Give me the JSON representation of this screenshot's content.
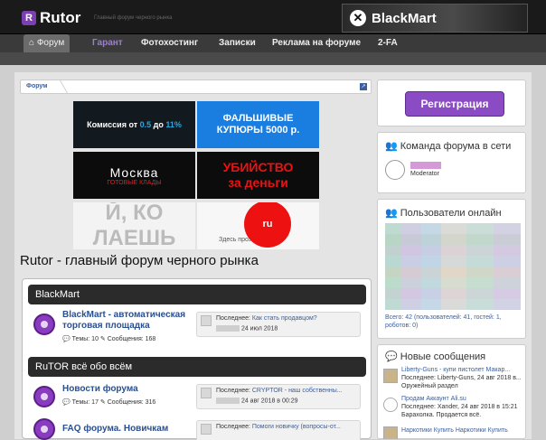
{
  "header": {
    "logo_text": "Rutor",
    "tagline": "Главный форум черного рынка",
    "banner_text": "BlackMart"
  },
  "nav": {
    "items": [
      {
        "label": "Форум",
        "icon": "home-icon",
        "active": true
      },
      {
        "label": "Гарант"
      },
      {
        "label": "Фотохостинг"
      },
      {
        "label": "Записки"
      },
      {
        "label": "Реклама на форуме"
      },
      {
        "label": "2-FA"
      }
    ]
  },
  "breadcrumb": {
    "label": "Форум"
  },
  "ads": {
    "ad1": {
      "prefix": "Комиссия от ",
      "a": "0.5",
      "mid": " до ",
      "b": "11%"
    },
    "ad2": {
      "line1": "ФАЛЬШИВЫЕ",
      "line2": "КУПЮРЫ 5000 р."
    },
    "ad3": {
      "line1": "Москва",
      "line2": "ГОТОВЫЕ КЛАДЫ"
    },
    "ad4": {
      "line1": "УБИЙСТВО",
      "line2": "за деньги"
    },
    "ad5": {
      "text": "Й, КО ЛАЕШЬ"
    },
    "ad6": {
      "circle": "ru",
      "small": "Здесь проз"
    }
  },
  "page_title": "Rutor - главный форум черного рынка",
  "categories": [
    {
      "title": "BlackMart",
      "forums": [
        {
          "title": "BlackMart - автоматическая торговая площадка",
          "topics": "Темы: 10",
          "messages": "Сообщения: 168",
          "last_label": "Последнее: ",
          "last_link": "Как стать продавцом?",
          "last_meta": "24 июл 2018"
        }
      ]
    },
    {
      "title": "RuTOR всё обо всём",
      "forums": [
        {
          "title": "Новости форума",
          "topics": "Темы: 17",
          "messages": "Сообщения: 316",
          "last_label": "Последнее: ",
          "last_link": "CRYPTOR - наш собственны...",
          "last_meta": "24 авг 2018 в 00:29"
        },
        {
          "title": "FAQ форума. Новичкам",
          "last_label": "Последнее: ",
          "last_link": "Помоги новичку (вопросы-от..."
        }
      ]
    }
  ],
  "sidebar": {
    "register_label": "Регистрация",
    "team_title": "Команда форума в сети",
    "team_member_role": "Moderator",
    "online_title": "Пользователи онлайн",
    "online_stats": "Всего: 42 (пользователей: 41, гостей: 1, роботов: 0)",
    "new_posts_title": "Новые сообщения",
    "posts": [
      {
        "title": "Liberty-Guns - купи пистолет Макар...",
        "meta": "Последнее: Liberty-Guns, 24 авг 2018 в...",
        "section": "Оружейный раздел"
      },
      {
        "title": "Продам Аккаунт Ali.su",
        "meta": "Последнее: Xander, 24 авг 2018 в 15:21",
        "section": "Барахолка. Продается всё."
      },
      {
        "title": "Наркотики Купить Наркотики Купить"
      }
    ]
  },
  "colors": {
    "purple": "#8a4bc4",
    "header_bg": "#1a1a1a",
    "link": "#3a5fa0"
  }
}
